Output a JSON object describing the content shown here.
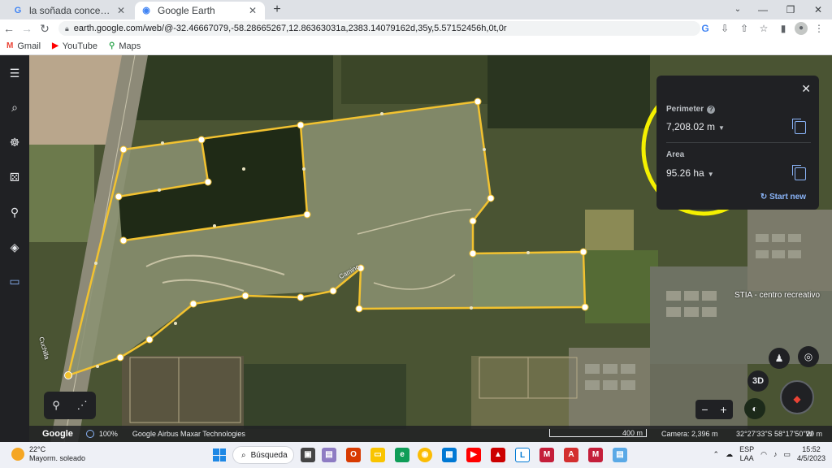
{
  "browser": {
    "tabs": [
      {
        "favicon": "G",
        "title": "la soñada concepcion del urugua",
        "close": "✕"
      },
      {
        "favicon": "◉",
        "title": "Google Earth",
        "close": "✕"
      }
    ],
    "new_tab": "+",
    "url": "earth.google.com/web/@-32.46667079,-58.28665267,12.86363031a,2383.14079162d,35y,5.57152456h,0t,0r",
    "bookmarks": [
      {
        "icon": "M",
        "label": "Gmail",
        "color": "#ea4335"
      },
      {
        "icon": "▶",
        "label": "YouTube",
        "color": "#ff0000"
      },
      {
        "icon": "⚲",
        "label": "Maps",
        "color": "#34a853"
      }
    ]
  },
  "measure": {
    "perimeter_label": "Perimeter",
    "perimeter_value": "7,208.02 m",
    "area_label": "Area",
    "area_value": "95.26 ha",
    "start_new": "Start new"
  },
  "map": {
    "place_label": "STIA - centro recreativo",
    "road_label": "Cuchilla",
    "road_label_2": "Camino"
  },
  "status": {
    "logo": "Google",
    "zoom": "100%",
    "attribution": "Google  Airbus  Maxar Technologies",
    "scale": "400 m",
    "camera": "Camera: 2,396 m",
    "coords": "32°27'33\"S 58°17'50\"W",
    "elevation": "29 m"
  },
  "controls": {
    "three_d": "3D",
    "zoom_out": "−",
    "zoom_in": "+"
  },
  "taskbar": {
    "temperature": "22°C",
    "weather": "Mayorm. soleado",
    "search": "Búsqueda",
    "lang_top": "ESP",
    "lang_bottom": "LAA",
    "time": "15:52",
    "date": "4/5/2023"
  }
}
